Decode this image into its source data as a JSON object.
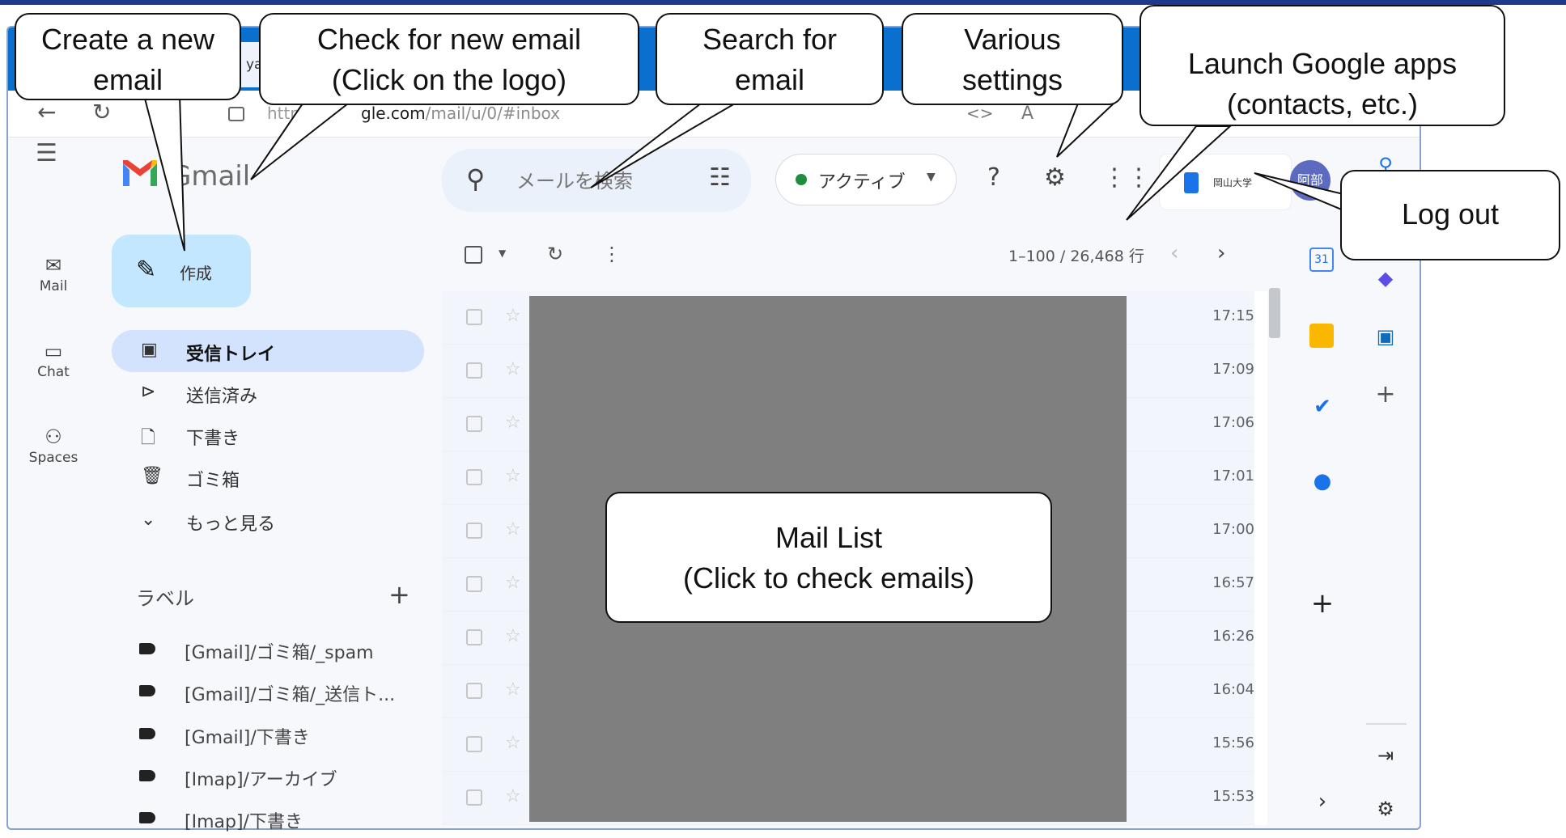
{
  "browser": {
    "tab_fragment": "ya",
    "url_prefix": "https:",
    "url_host_tail": "gle.com",
    "url_path": "/mail/u/0/#inbox",
    "translate_label": "A"
  },
  "app": {
    "brand": "Gmail",
    "compose_label": "作成",
    "search_placeholder": "メールを検索",
    "status_label": "アクティブ",
    "org_name": "岡山大学",
    "avatar_text": "阿部"
  },
  "rail": {
    "mail": "Mail",
    "chat": "Chat",
    "spaces": "Spaces"
  },
  "nav": [
    {
      "label": "受信トレイ",
      "icon": "inbox-icon"
    },
    {
      "label": "送信済み",
      "icon": "send-icon"
    },
    {
      "label": "下書き",
      "icon": "draft-icon"
    },
    {
      "label": "ゴミ箱",
      "icon": "trash-icon"
    },
    {
      "label": "もっと見る",
      "icon": "chevron-down-icon"
    }
  ],
  "labels": {
    "heading": "ラベル",
    "items": [
      "[Gmail]/ゴミ箱/_spam",
      "[Gmail]/ゴミ箱/_送信ト...",
      "[Gmail]/下書き",
      "[Imap]/アーカイブ",
      "[Imap]/下書き"
    ]
  },
  "toolbar": {
    "range": "1–100 / 26,468 行"
  },
  "mail_times": [
    "17:15",
    "17:09",
    "17:06",
    "17:01",
    "17:00",
    "16:57",
    "16:26",
    "16:04",
    "15:56",
    "15:53"
  ],
  "callouts": {
    "compose": [
      "Create a new",
      "email"
    ],
    "refresh": [
      "Check for new email",
      "(Click on the logo)"
    ],
    "search": [
      "Search for",
      "email"
    ],
    "settings": [
      "Various",
      "settings"
    ],
    "apps": [
      "Launch Google apps",
      "(contacts, etc.)"
    ],
    "logout": [
      "Log out"
    ],
    "maillist": [
      "Mail List",
      "(Click to check emails)"
    ]
  }
}
